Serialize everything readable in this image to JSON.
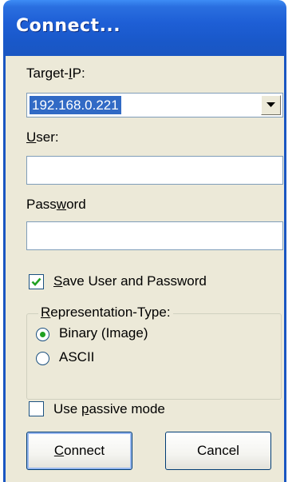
{
  "window": {
    "title": "Connect..."
  },
  "target_ip": {
    "label_pre": "Target-",
    "label_accel": "I",
    "label_post": "P:",
    "value": "192.168.0.221"
  },
  "user": {
    "label_accel": "U",
    "label_post": "ser:",
    "value": ""
  },
  "password": {
    "label_pre": "Pass",
    "label_accel": "w",
    "label_post": "ord",
    "value": ""
  },
  "save_credentials": {
    "label_accel": "S",
    "label_post": "ave User and Password",
    "checked": true
  },
  "representation": {
    "legend_accel": "R",
    "legend_post": "epresentation-Type:",
    "options": [
      {
        "label": "Binary (Image)",
        "selected": true
      },
      {
        "label": "ASCII",
        "selected": false
      }
    ]
  },
  "passive_mode": {
    "label_pre": "Use ",
    "label_accel": "p",
    "label_post": "assive mode",
    "checked": false
  },
  "buttons": {
    "connect_accel": "C",
    "connect_post": "onnect",
    "cancel": "Cancel"
  },
  "colors": {
    "titlebar": "#1e5fd6",
    "dialog_bg": "#ece9d8",
    "selection": "#316ac5",
    "radio_dot": "#21a121"
  }
}
